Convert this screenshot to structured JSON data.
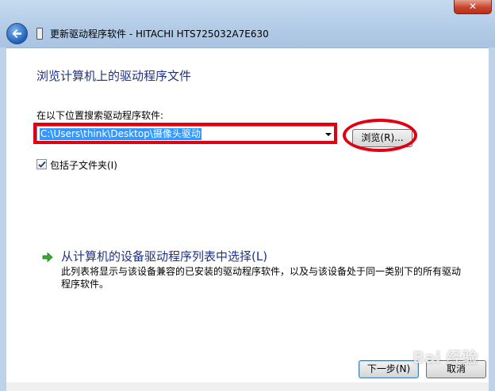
{
  "window": {
    "title": "更新驱动程序软件 - HITACHI HTS725032A7E630",
    "close_symbol": "✕"
  },
  "page": {
    "heading": "浏览计算机上的驱动程序文件",
    "search_label": "在以下位置搜索驱动程序软件:",
    "path_value": "C:\\Users\\think\\Desktop\\摄像头驱动",
    "browse_label": "浏览(R)...",
    "include_subfolders_label": "包括子文件夹(I)",
    "include_subfolders_checked": true,
    "pick_from_list_title": "从计算机的设备驱动程序列表中选择(L)",
    "pick_from_list_desc": "此列表将显示与该设备兼容的已安装的驱动程序软件，以及与该设备处于同一类别下的所有驱动程序软件。"
  },
  "footer": {
    "next_label": "下一步(N)",
    "cancel_label": "取消"
  },
  "watermark": "Bai 经验",
  "colors": {
    "heading": "#1e3287",
    "selection": "#3399ff",
    "annotation_red": "#e00012"
  },
  "icons": {
    "back": "back-arrow-icon",
    "device": "hard-drive-icon",
    "link_arrow": "green-arrow-icon",
    "check": "checkmark-icon"
  }
}
